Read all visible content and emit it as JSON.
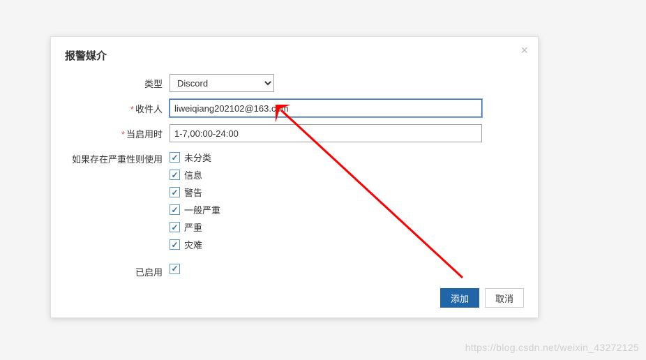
{
  "modal": {
    "title": "报警媒介",
    "close_label": "×"
  },
  "form": {
    "type_label": "类型",
    "type_value": "Discord",
    "recipient_label": "收件人",
    "recipient_value": "liweiqiang202102@163.com",
    "when_active_label": "当启用时",
    "when_active_value": "1-7,00:00-24:00",
    "severity_label": "如果存在严重性则使用",
    "enabled_label": "已启用"
  },
  "severities": [
    {
      "label": "未分类",
      "checked": true
    },
    {
      "label": "信息",
      "checked": true
    },
    {
      "label": "警告",
      "checked": true
    },
    {
      "label": "一般严重",
      "checked": true
    },
    {
      "label": "严重",
      "checked": true
    },
    {
      "label": "灾难",
      "checked": true
    }
  ],
  "buttons": {
    "add": "添加",
    "cancel": "取消"
  },
  "watermark": "https://blog.csdn.net/weixin_43272125"
}
